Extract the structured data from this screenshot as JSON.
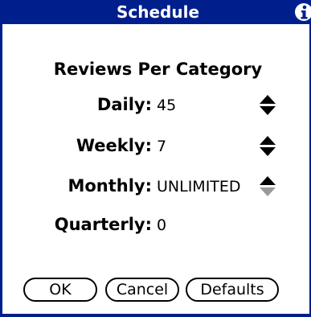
{
  "titlebar": {
    "title": "Schedule",
    "info_icon": "info-icon"
  },
  "form": {
    "heading": "Reviews Per Category",
    "rows": [
      {
        "label": "Daily:",
        "value": "45"
      },
      {
        "label": "Weekly:",
        "value": "7"
      },
      {
        "label": "Monthly:",
        "value": "UNLIMITED"
      },
      {
        "label": "Quarterly:",
        "value": "0"
      }
    ]
  },
  "buttons": {
    "ok": "OK",
    "cancel": "Cancel",
    "defaults": "Defaults"
  },
  "colors": {
    "titlebar": "#001f8c",
    "background": "#ffffff",
    "text": "#000000",
    "disabled_arrow": "#9a9a9a"
  }
}
